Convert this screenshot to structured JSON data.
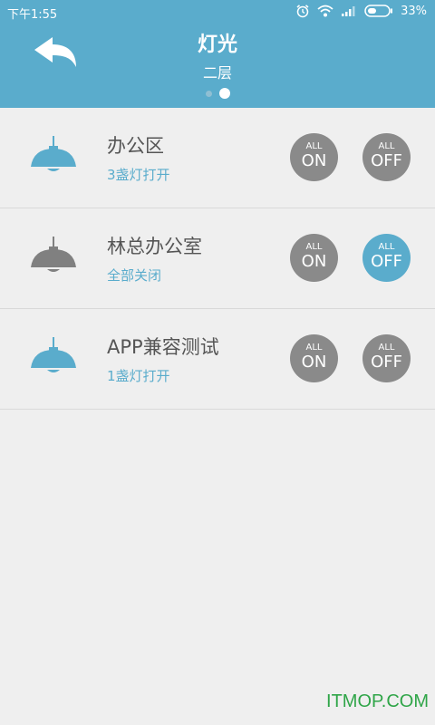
{
  "status_bar": {
    "time": "下午1:55",
    "battery": "33%"
  },
  "header": {
    "title": "灯光",
    "subtitle": "二层"
  },
  "rows": [
    {
      "name": "办公区",
      "status": "3盏灯打开",
      "on_small": "ALL",
      "on_big": "ON",
      "off_small": "ALL",
      "off_big": "OFF",
      "lamp_color": "#5aaccc",
      "active": "none"
    },
    {
      "name": "林总办公室",
      "status": "全部关闭",
      "on_small": "ALL",
      "on_big": "ON",
      "off_small": "ALL",
      "off_big": "OFF",
      "lamp_color": "#808080",
      "active": "off"
    },
    {
      "name": "APP兼容测试",
      "status": "1盏灯打开",
      "on_small": "ALL",
      "on_big": "ON",
      "off_small": "ALL",
      "off_big": "OFF",
      "lamp_color": "#5aaccc",
      "active": "none"
    }
  ],
  "watermark": "ITMOP.COM"
}
